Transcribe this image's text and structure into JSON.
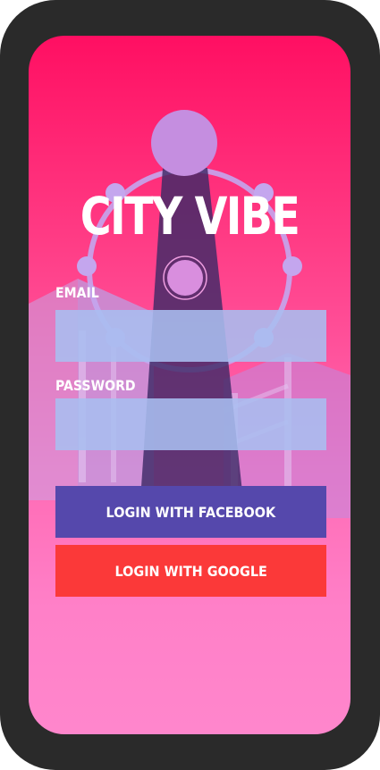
{
  "app": {
    "title": "CITY VIBE"
  },
  "form": {
    "email_label": "EMAIL",
    "email_value": "",
    "password_label": "PASSWORD",
    "password_value": ""
  },
  "buttons": {
    "facebook_label": "LOGIN WITH FACEBOOK",
    "google_label": "LOGIN WITH GOOGLE"
  },
  "colors": {
    "gradient_top": "#ff0f62",
    "gradient_bottom": "#ff86cc",
    "facebook_button": "#5548ac",
    "google_button": "#fb3939",
    "input_fill": "#a8bef0",
    "device_frame": "#2a2a2a"
  },
  "icons": {
    "background_illustration": "city-skyline-ferris-wheel-illustration"
  }
}
